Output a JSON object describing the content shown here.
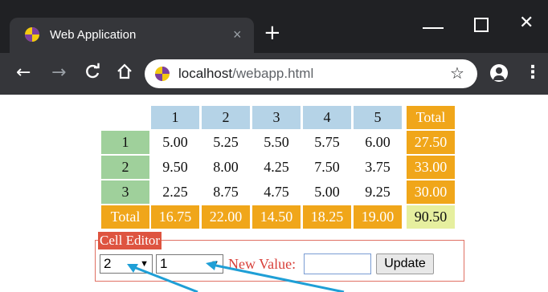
{
  "browser": {
    "tab_title": "Web Application",
    "tab_close": "×",
    "new_tab": "+",
    "url_host": "localhost",
    "url_path": "/webapp.html",
    "back": "←",
    "forward": "→",
    "reload": "C",
    "home": "⌂",
    "bookmark": "☆",
    "menu": "⋮",
    "minimize": "",
    "close": "✕"
  },
  "table": {
    "col_headers": [
      "1",
      "2",
      "3",
      "4",
      "5"
    ],
    "total_label": "Total",
    "rows": [
      {
        "label": "1",
        "values": [
          "5.00",
          "5.25",
          "5.50",
          "5.75",
          "6.00"
        ],
        "total": "27.50"
      },
      {
        "label": "2",
        "values": [
          "9.50",
          "8.00",
          "4.25",
          "7.50",
          "3.75"
        ],
        "total": "33.00"
      },
      {
        "label": "3",
        "values": [
          "2.25",
          "8.75",
          "4.75",
          "5.00",
          "9.25"
        ],
        "total": "30.00"
      }
    ],
    "col_totals": [
      "16.75",
      "22.00",
      "14.50",
      "18.25",
      "19.00"
    ],
    "grand_total": "90.50"
  },
  "editor": {
    "legend": "Cell Editor",
    "row_select_value": "2",
    "col_select_value": "1",
    "new_value_label": "New Value:",
    "new_value": "",
    "update_label": "Update",
    "caret": "▼"
  },
  "colors": {
    "header_blue": "#b5d3e7",
    "row_header_green": "#9fd09b",
    "total_orange": "#f0a61a",
    "grand_total_yellow": "#e6ef9f",
    "legend_red": "#de5440",
    "arrow_blue": "#1f9fd6"
  }
}
